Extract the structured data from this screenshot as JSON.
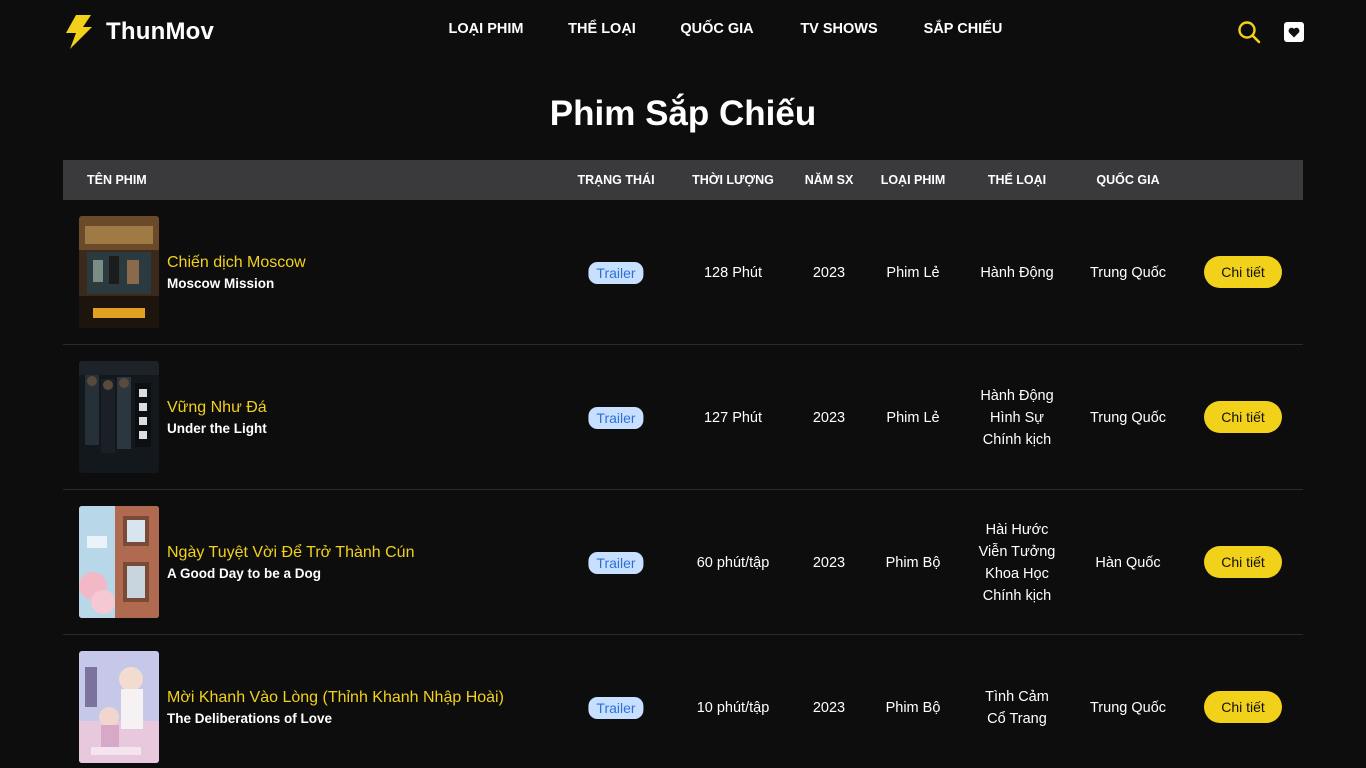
{
  "brand": {
    "name": "ThunMov",
    "accent": "#f2d11b"
  },
  "nav": [
    {
      "label": "LOẠI PHIM"
    },
    {
      "label": "THỂ LOẠI"
    },
    {
      "label": "QUỐC GIA"
    },
    {
      "label": "TV SHOWS"
    },
    {
      "label": "SẮP CHIẾU"
    }
  ],
  "header_icons": {
    "search": "search-icon",
    "favorites": "heart-icon"
  },
  "page_title": "Phim Sắp Chiếu",
  "table": {
    "columns": {
      "name": "TÊN PHIM",
      "status": "TRẠNG THÁI",
      "duration": "THỜI LƯỢNG",
      "year": "NĂM SX",
      "type": "LOẠI PHIM",
      "genre": "THỂ LOẠI",
      "country": "QUỐC GIA"
    },
    "rows": [
      {
        "title_vi": "Chiến dịch Moscow",
        "title_en": "Moscow Mission",
        "status": "Trailer",
        "duration": "128 Phút",
        "year": "2023",
        "type": "Phim Lẻ",
        "genres": [
          "Hành Động"
        ],
        "country": "Trung Quốc",
        "action": "Chi tiết"
      },
      {
        "title_vi": "Vững Như Đá",
        "title_en": "Under the Light",
        "status": "Trailer",
        "duration": "127 Phút",
        "year": "2023",
        "type": "Phim Lẻ",
        "genres": [
          "Hành Động",
          "Hình Sự",
          "Chính kịch"
        ],
        "country": "Trung Quốc",
        "action": "Chi tiết"
      },
      {
        "title_vi": "Ngày Tuyệt Vời Để Trở Thành Cún",
        "title_en": "A Good Day to be a Dog",
        "status": "Trailer",
        "duration": "60 phút/tập",
        "year": "2023",
        "type": "Phim Bộ",
        "genres": [
          "Hài Hước",
          "Viễn Tưởng",
          "Khoa Học",
          "Chính kịch"
        ],
        "country": "Hàn Quốc",
        "action": "Chi tiết"
      },
      {
        "title_vi": "Mời Khanh Vào Lòng (Thỉnh Khanh Nhập Hoài)",
        "title_en": "The Deliberations of Love",
        "status": "Trailer",
        "duration": "10 phút/tập",
        "year": "2023",
        "type": "Phim Bộ",
        "genres": [
          "Tình Cảm",
          "Cổ Trang"
        ],
        "country": "Trung Quốc",
        "action": "Chi tiết"
      }
    ]
  }
}
